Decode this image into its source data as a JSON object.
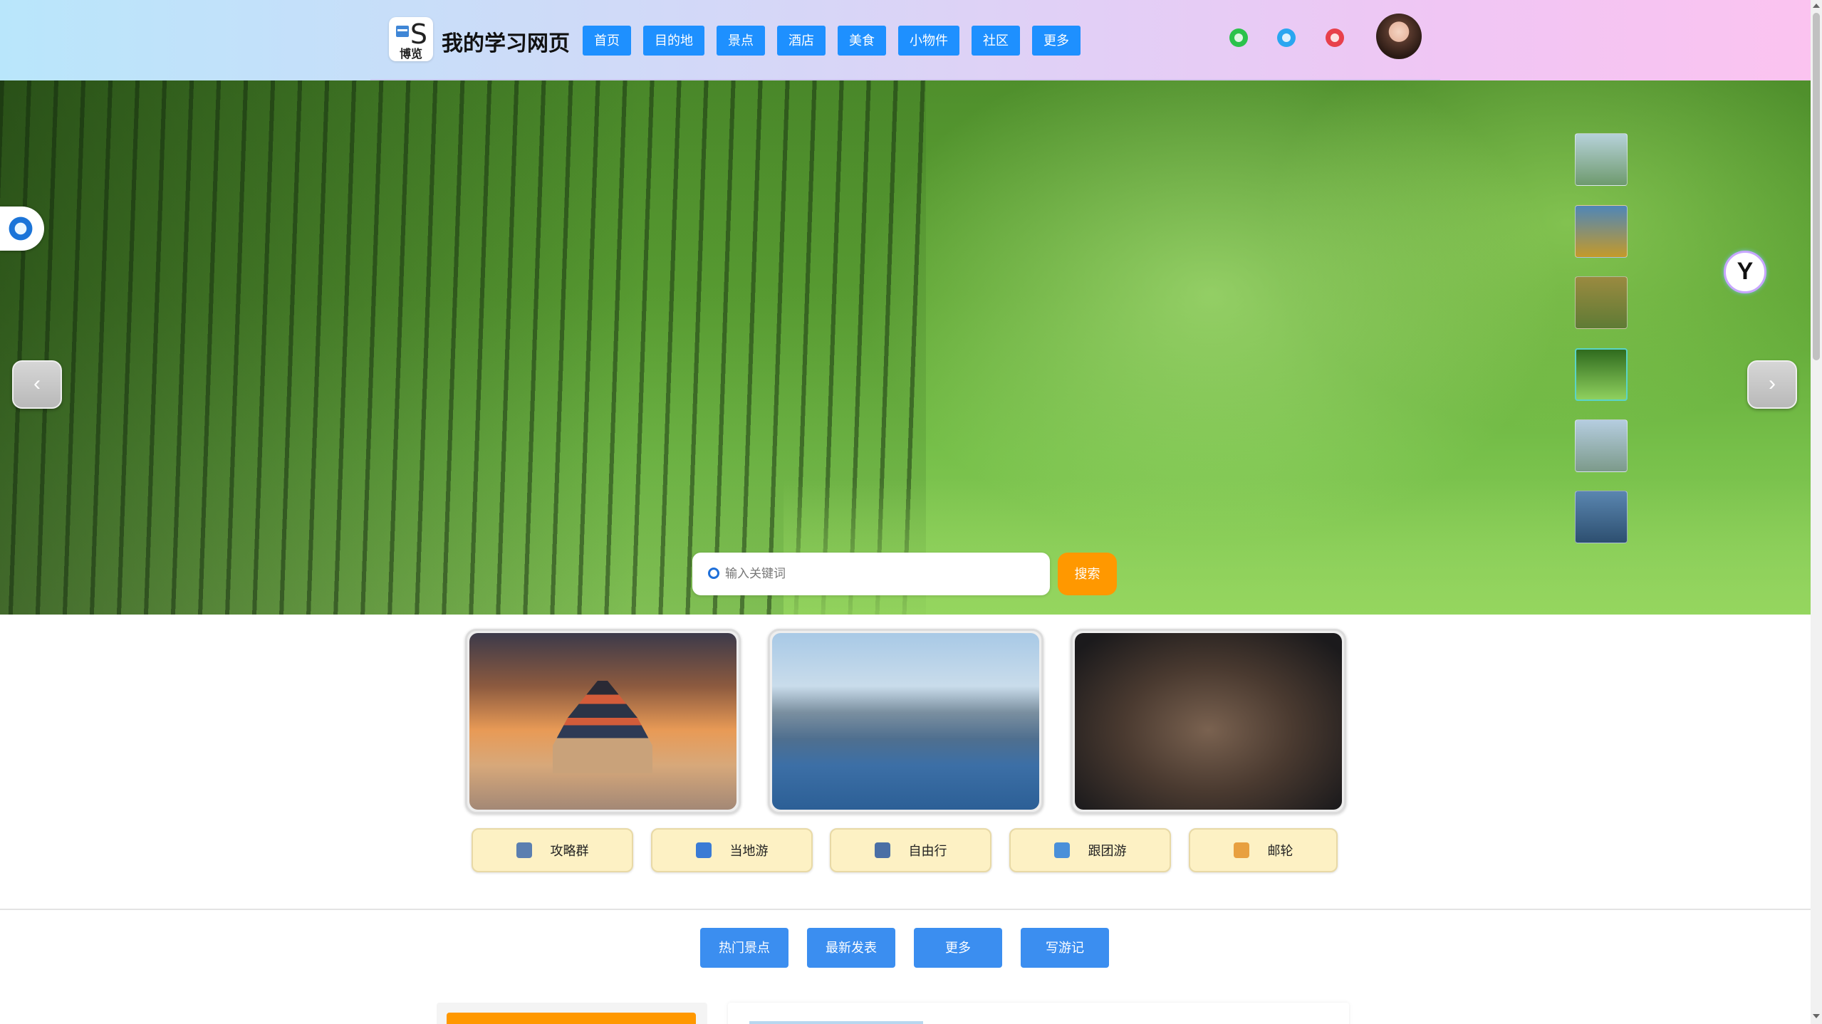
{
  "header": {
    "logo_letter": "S",
    "logo_sub": "博览",
    "site_title": "我的学习网页",
    "nav": [
      "首页",
      "目的地",
      "景点",
      "酒店",
      "美食",
      "小物件",
      "社区",
      "更多"
    ],
    "social_icons": [
      "wechat-icon",
      "qq-icon",
      "weibo-icon"
    ]
  },
  "hero": {
    "prev_label": "‹",
    "next_label": "›",
    "thumbnails": [
      {
        "name": "mountain-lake",
        "colors": [
          "#b7d2da",
          "#6e9a6e"
        ]
      },
      {
        "name": "snow-peak-autumn",
        "colors": [
          "#4f86b8",
          "#c49a2a"
        ]
      },
      {
        "name": "golden-grassland",
        "colors": [
          "#9a8a40",
          "#5f7b35"
        ]
      },
      {
        "name": "bamboo-forest",
        "colors": [
          "#2f6b1e",
          "#8fd05e"
        ],
        "active": true
      },
      {
        "name": "misty-river",
        "colors": [
          "#b5cde0",
          "#7c9a8a"
        ]
      },
      {
        "name": "blue-mountains",
        "colors": [
          "#5a86b0",
          "#2d4f70"
        ]
      }
    ],
    "float_right_glyph": "Y"
  },
  "search": {
    "placeholder": "输入关键词",
    "button": "搜索"
  },
  "categories": [
    {
      "label": "攻略群",
      "icon": "guidebook-icon",
      "color": "#5b7fb0"
    },
    {
      "label": "当地游",
      "icon": "local-tour-icon",
      "color": "#3a7bd5"
    },
    {
      "label": "自由行",
      "icon": "plane-icon",
      "color": "#4a6fa5"
    },
    {
      "label": "跟团游",
      "icon": "flag-icon",
      "color": "#4a90d9"
    },
    {
      "label": "邮轮",
      "icon": "cruise-icon",
      "color": "#e8a040"
    }
  ],
  "tabs": [
    "热门景点",
    "最新发表",
    "更多",
    "写游记"
  ],
  "colors": {
    "nav_bg": "#1e90ff",
    "search_button": "#ff9800",
    "category_bg": "#fdf1c4",
    "tab_bg": "#3b8ef0"
  }
}
